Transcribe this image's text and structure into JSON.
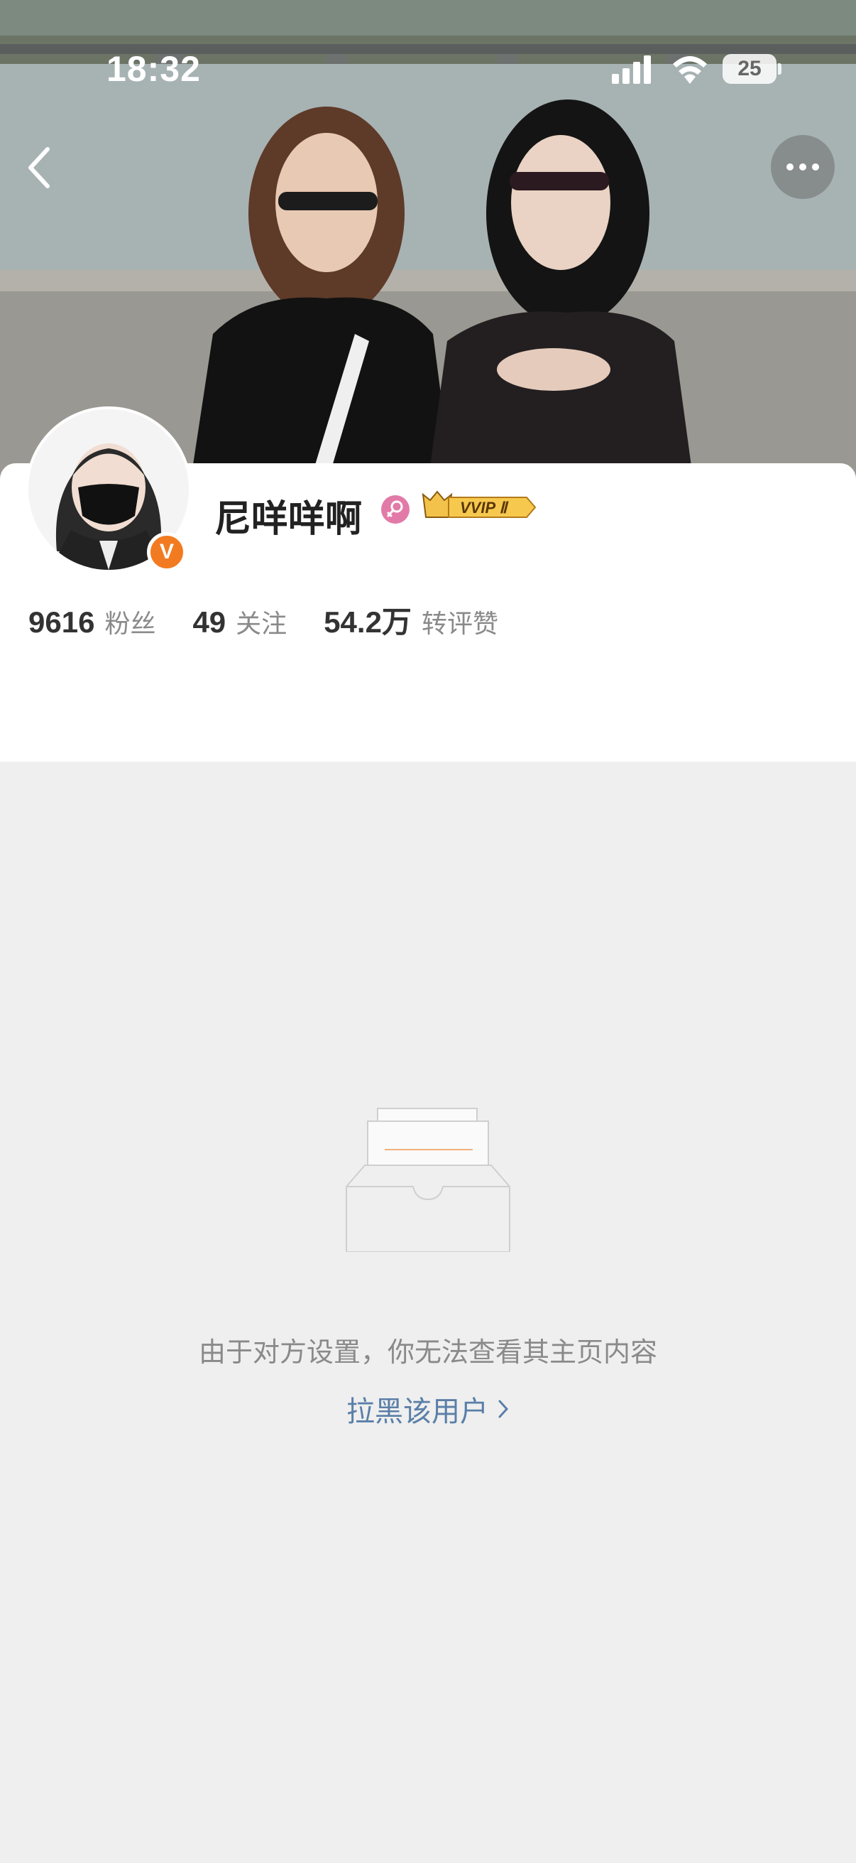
{
  "status_bar": {
    "time": "18:32",
    "battery": "25"
  },
  "profile": {
    "username": "尼咩咩啊",
    "verified_mark": "V",
    "vip_label": "VVIP Ⅱ",
    "stats": [
      {
        "value": "9616",
        "label": "粉丝"
      },
      {
        "value": "49",
        "label": "关注"
      },
      {
        "value": "54.2万",
        "label": "转评赞"
      }
    ]
  },
  "empty_state": {
    "message": "由于对方设置，你无法查看其主页内容",
    "block_link": "拉黑该用户"
  },
  "colors": {
    "accent_orange": "#f27b22",
    "link_blue": "#5a7fa8",
    "page_bg": "#efefef",
    "gender_pink": "#e27aa8",
    "vip_gold": "#f3c24a"
  },
  "icons": [
    "back-arrow-icon",
    "more-icon",
    "signal-icon",
    "wifi-icon",
    "battery-icon",
    "female-icon",
    "crown-icon",
    "chevron-right-icon",
    "empty-box-icon"
  ]
}
